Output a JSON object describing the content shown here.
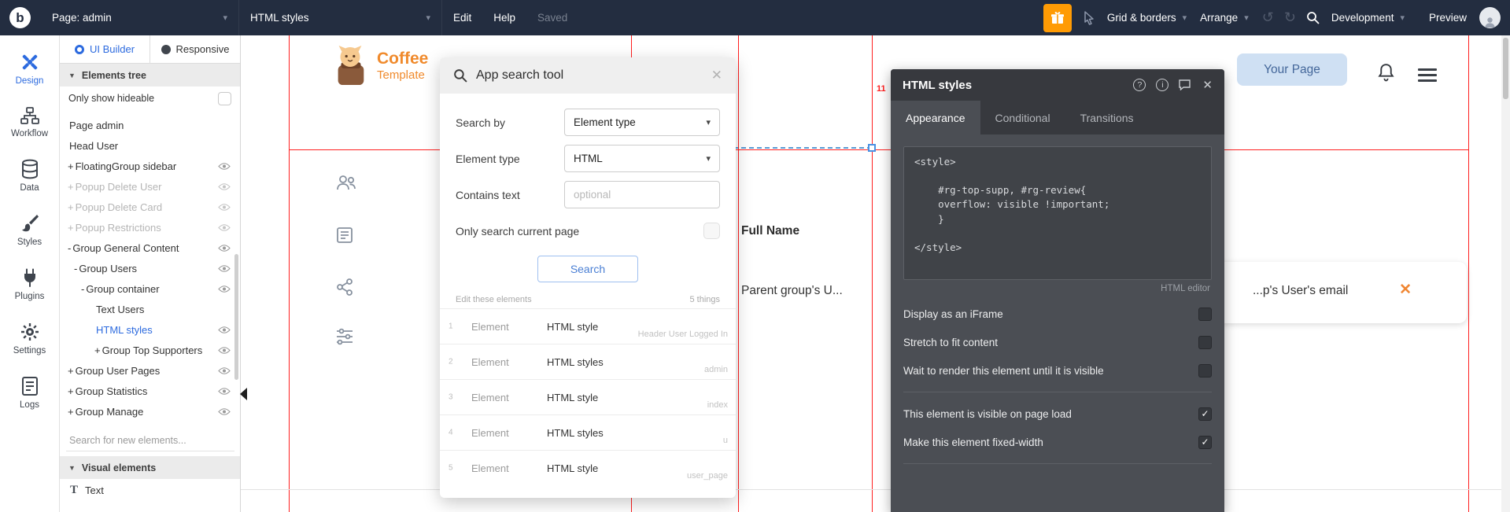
{
  "topbar": {
    "logo_letter": "b",
    "page_selector": "Page: admin",
    "element_selector": "HTML styles",
    "menu_edit": "Edit",
    "menu_help": "Help",
    "saved_status": "Saved",
    "grid_borders": "Grid & borders",
    "arrange": "Arrange",
    "undo_glyph": "↺",
    "redo_glyph": "↻",
    "environment": "Development",
    "preview": "Preview",
    "caret": "▾"
  },
  "nav_rail": {
    "items": [
      {
        "label": "Design",
        "icon": "design-icon",
        "active": true
      },
      {
        "label": "Workflow",
        "icon": "workflow-icon",
        "active": false
      },
      {
        "label": "Data",
        "icon": "database-icon",
        "active": false
      },
      {
        "label": "Styles",
        "icon": "brush-icon",
        "active": false
      },
      {
        "label": "Plugins",
        "icon": "plug-icon",
        "active": false
      },
      {
        "label": "Settings",
        "icon": "gear-icon",
        "active": false
      },
      {
        "label": "Logs",
        "icon": "logs-icon",
        "active": false
      }
    ]
  },
  "elements_panel": {
    "tab_ui_builder": "UI Builder",
    "tab_responsive": "Responsive",
    "tree_header": "Elements tree",
    "only_show_hideable": "Only show hideable",
    "tree": [
      {
        "prefix": "",
        "label": "Page admin",
        "level": 0,
        "muted": false,
        "selected": false,
        "eye": false
      },
      {
        "prefix": "",
        "label": "Head User",
        "level": 0,
        "muted": false,
        "selected": false,
        "eye": false
      },
      {
        "prefix": "+",
        "label": "FloatingGroup sidebar",
        "level": 0,
        "muted": false,
        "selected": false,
        "eye": true
      },
      {
        "prefix": "+",
        "label": "Popup Delete User",
        "level": 0,
        "muted": true,
        "selected": false,
        "eye": true
      },
      {
        "prefix": "+",
        "label": "Popup Delete Card",
        "level": 0,
        "muted": true,
        "selected": false,
        "eye": true
      },
      {
        "prefix": "+",
        "label": "Popup Restrictions",
        "level": 0,
        "muted": true,
        "selected": false,
        "eye": true
      },
      {
        "prefix": "-",
        "label": "Group General Content",
        "level": 0,
        "muted": false,
        "selected": false,
        "eye": true
      },
      {
        "prefix": "-",
        "label": "Group Users",
        "level": 1,
        "muted": false,
        "selected": false,
        "eye": true
      },
      {
        "prefix": "-",
        "label": "Group container",
        "level": 2,
        "muted": false,
        "selected": false,
        "eye": true
      },
      {
        "prefix": "",
        "label": "Text Users",
        "level": 3,
        "muted": false,
        "selected": false,
        "eye": false
      },
      {
        "prefix": "",
        "label": "HTML styles",
        "level": 3,
        "muted": false,
        "selected": true,
        "eye": true
      },
      {
        "prefix": "+",
        "label": "Group Top Supporters",
        "level": 3,
        "muted": false,
        "selected": false,
        "eye": true
      },
      {
        "prefix": "+",
        "label": "Group User Pages",
        "level": 0,
        "muted": false,
        "selected": false,
        "eye": true
      },
      {
        "prefix": "+",
        "label": "Group Statistics",
        "level": 0,
        "muted": false,
        "selected": false,
        "eye": true
      },
      {
        "prefix": "+",
        "label": "Group Manage",
        "level": 0,
        "muted": false,
        "selected": false,
        "eye": true
      }
    ],
    "search_placeholder": "Search for new elements...",
    "visual_elements_header": "Visual elements",
    "text_element_icon": "T",
    "text_element_label": "Text"
  },
  "canvas": {
    "brand_name": "Coffee",
    "brand_sub": "Template",
    "grid_badge": "11",
    "table_header_full_name": "Full Name",
    "cell_parent_group": "Parent group's U...",
    "cell_user_email": "...p's User's email",
    "email_close_glyph": "✕",
    "your_page_button": "Your Page"
  },
  "search_popup": {
    "title": "App search tool",
    "close_glyph": "✕",
    "search_by_label": "Search by",
    "search_by_value": "Element type",
    "element_type_label": "Element type",
    "element_type_value": "HTML",
    "contains_text_label": "Contains text",
    "contains_text_placeholder": "optional",
    "only_current_page_label": "Only search current page",
    "search_button": "Search",
    "results_edit_label": "Edit these elements",
    "results_count": "5 things",
    "results": [
      {
        "index": "1",
        "type": "Element",
        "name": "HTML style",
        "context": "Header User Logged In"
      },
      {
        "index": "2",
        "type": "Element",
        "name": "HTML styles",
        "context": "admin"
      },
      {
        "index": "3",
        "type": "Element",
        "name": "HTML style",
        "context": "index"
      },
      {
        "index": "4",
        "type": "Element",
        "name": "HTML styles",
        "context": "u"
      },
      {
        "index": "5",
        "type": "Element",
        "name": "HTML style",
        "context": "user_page"
      }
    ]
  },
  "property_panel": {
    "title": "HTML styles",
    "help_glyph": "?",
    "info_glyph": "i",
    "close_glyph": "✕",
    "tabs": [
      {
        "label": "Appearance",
        "active": true
      },
      {
        "label": "Conditional",
        "active": false
      },
      {
        "label": "Transitions",
        "active": false
      }
    ],
    "code": "<style>\n\n    #rg-top-supp, #rg-review{\n    overflow: visible !important;\n    }\n\n</style>",
    "editor_label": "HTML editor",
    "options": [
      {
        "label": "Display as an iFrame",
        "checked": false
      },
      {
        "label": "Stretch to fit content",
        "checked": false
      },
      {
        "label": "Wait to render this element until it is visible",
        "checked": false
      },
      {
        "label": "This element is visible on page load",
        "checked": true
      },
      {
        "label": "Make this element fixed-width",
        "checked": true
      }
    ]
  },
  "colors": {
    "accent_blue": "#2d6bdf",
    "toolbar_orange": "#ff9b04",
    "brand_orange": "#f08a2c",
    "guide_red": "#ff1f1f",
    "selection_blue": "#4a90e2",
    "topbar_bg": "#232d40",
    "property_panel_bg": "#4b4e54"
  }
}
